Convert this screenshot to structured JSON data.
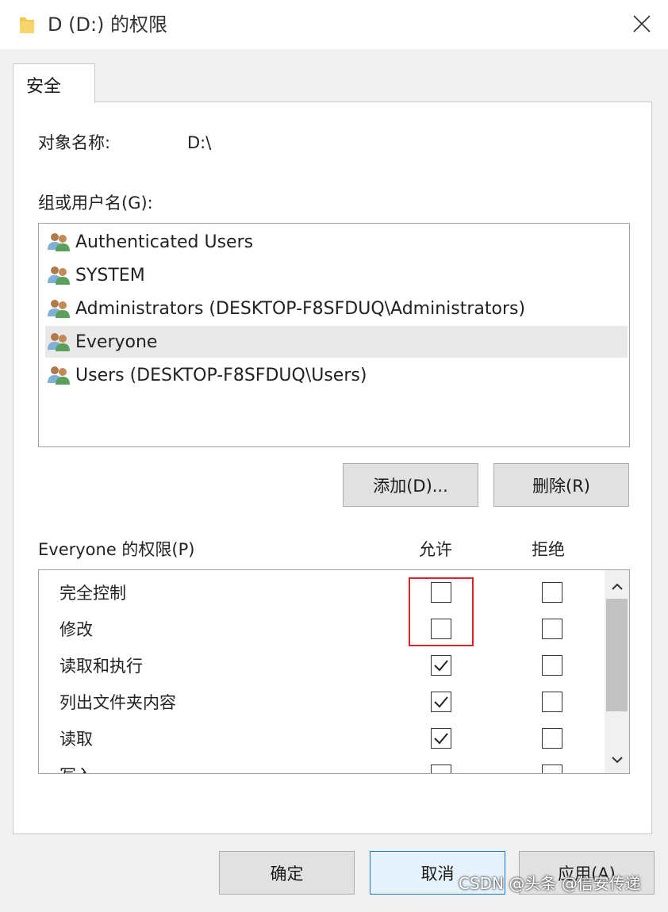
{
  "window": {
    "title": "D (D:) 的权限",
    "icon": "folder-icon",
    "close_icon": "close-icon"
  },
  "tabs": [
    {
      "label": "安全",
      "selected": true
    }
  ],
  "object": {
    "label": "对象名称:",
    "value": "D:\\"
  },
  "users": {
    "label": "组或用户名(G):",
    "items": [
      {
        "name": "Authenticated Users",
        "selected": false
      },
      {
        "name": "SYSTEM",
        "selected": false
      },
      {
        "name": "Administrators (DESKTOP-F8SFDUQ\\Administrators)",
        "selected": false
      },
      {
        "name": "Everyone",
        "selected": true
      },
      {
        "name": "Users (DESKTOP-F8SFDUQ\\Users)",
        "selected": false
      }
    ],
    "add_label": "添加(D)...",
    "remove_label": "删除(R)"
  },
  "permissions": {
    "label": "Everyone 的权限(P)",
    "allow_header": "允许",
    "deny_header": "拒绝",
    "rows": [
      {
        "name": "完全控制",
        "allow": false,
        "deny": false
      },
      {
        "name": "修改",
        "allow": false,
        "deny": false
      },
      {
        "name": "读取和执行",
        "allow": true,
        "deny": false
      },
      {
        "name": "列出文件夹内容",
        "allow": true,
        "deny": false
      },
      {
        "name": "读取",
        "allow": true,
        "deny": false
      },
      {
        "name": "写入",
        "allow": false,
        "deny": false
      }
    ]
  },
  "footer": {
    "ok_label": "确定",
    "cancel_label": "取消",
    "apply_label": "应用(A)"
  },
  "watermark": "CSDN @头条 @信安传递",
  "colors": {
    "highlight": "#d9232a",
    "primary_border": "#0078d7"
  }
}
